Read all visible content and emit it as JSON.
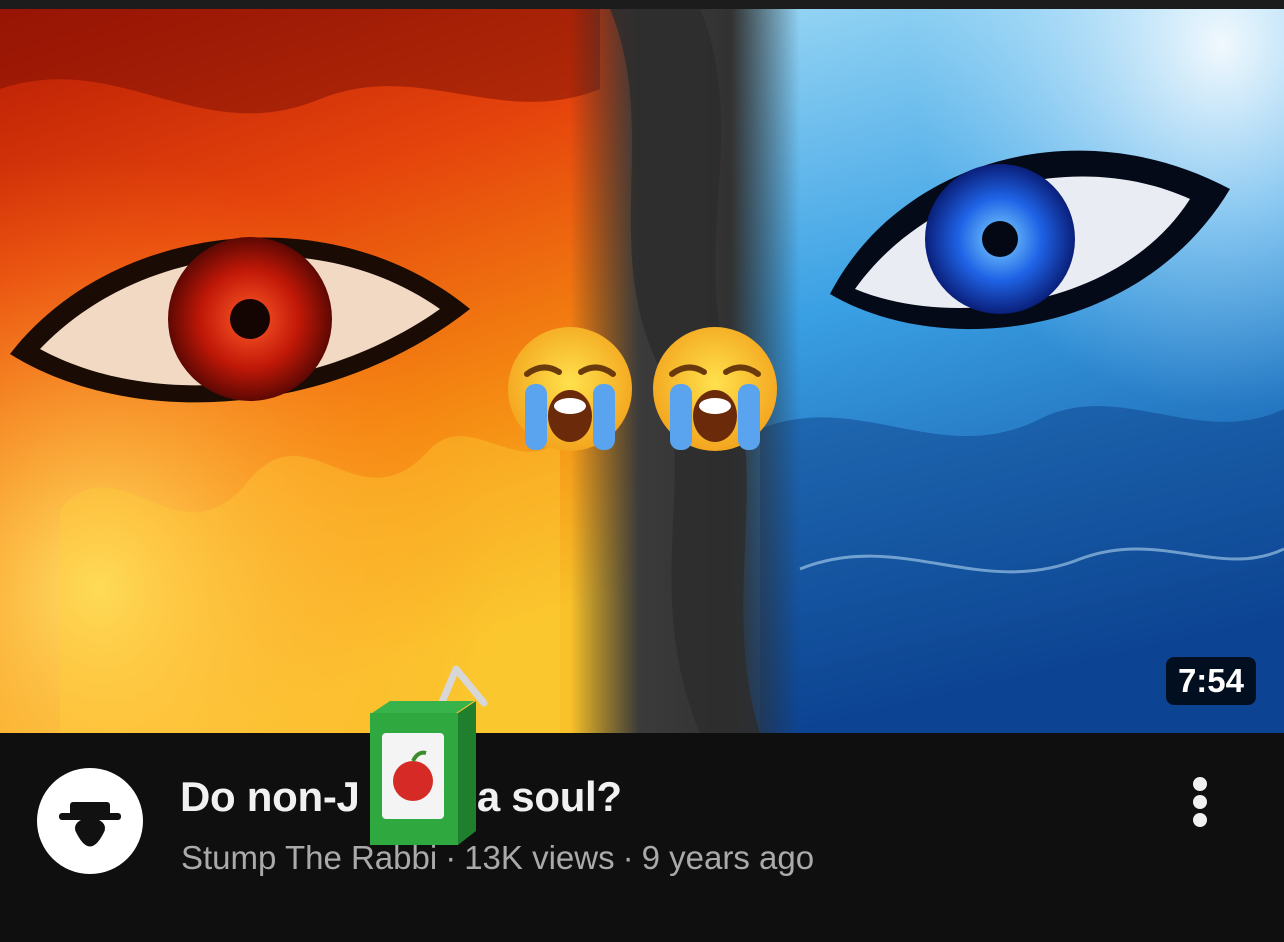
{
  "video": {
    "title": "Do non-J have a soul?",
    "title_part1": "Do non-J",
    "title_part2": " have a soul?",
    "channel": "Stump The Rabbi",
    "views": "13K views",
    "age": "9 years ago",
    "separator": "·",
    "duration": "7:54"
  },
  "thumbnail": {
    "left_theme": "fire-eye",
    "right_theme": "ice-eye",
    "overlay_icons": [
      "loudly-crying-face-emoji",
      "loudly-crying-face-emoji"
    ],
    "colors": {
      "fire": "#e8420f",
      "ice": "#1f7fd4",
      "smoke": "#3a3a3a"
    }
  },
  "sticker": {
    "icon": "juice-box-emoji"
  },
  "channel_avatar": {
    "icon": "rabbi-silhouette-icon",
    "background": "#ffffff"
  },
  "menu": {
    "icon": "more-vertical-icon"
  }
}
